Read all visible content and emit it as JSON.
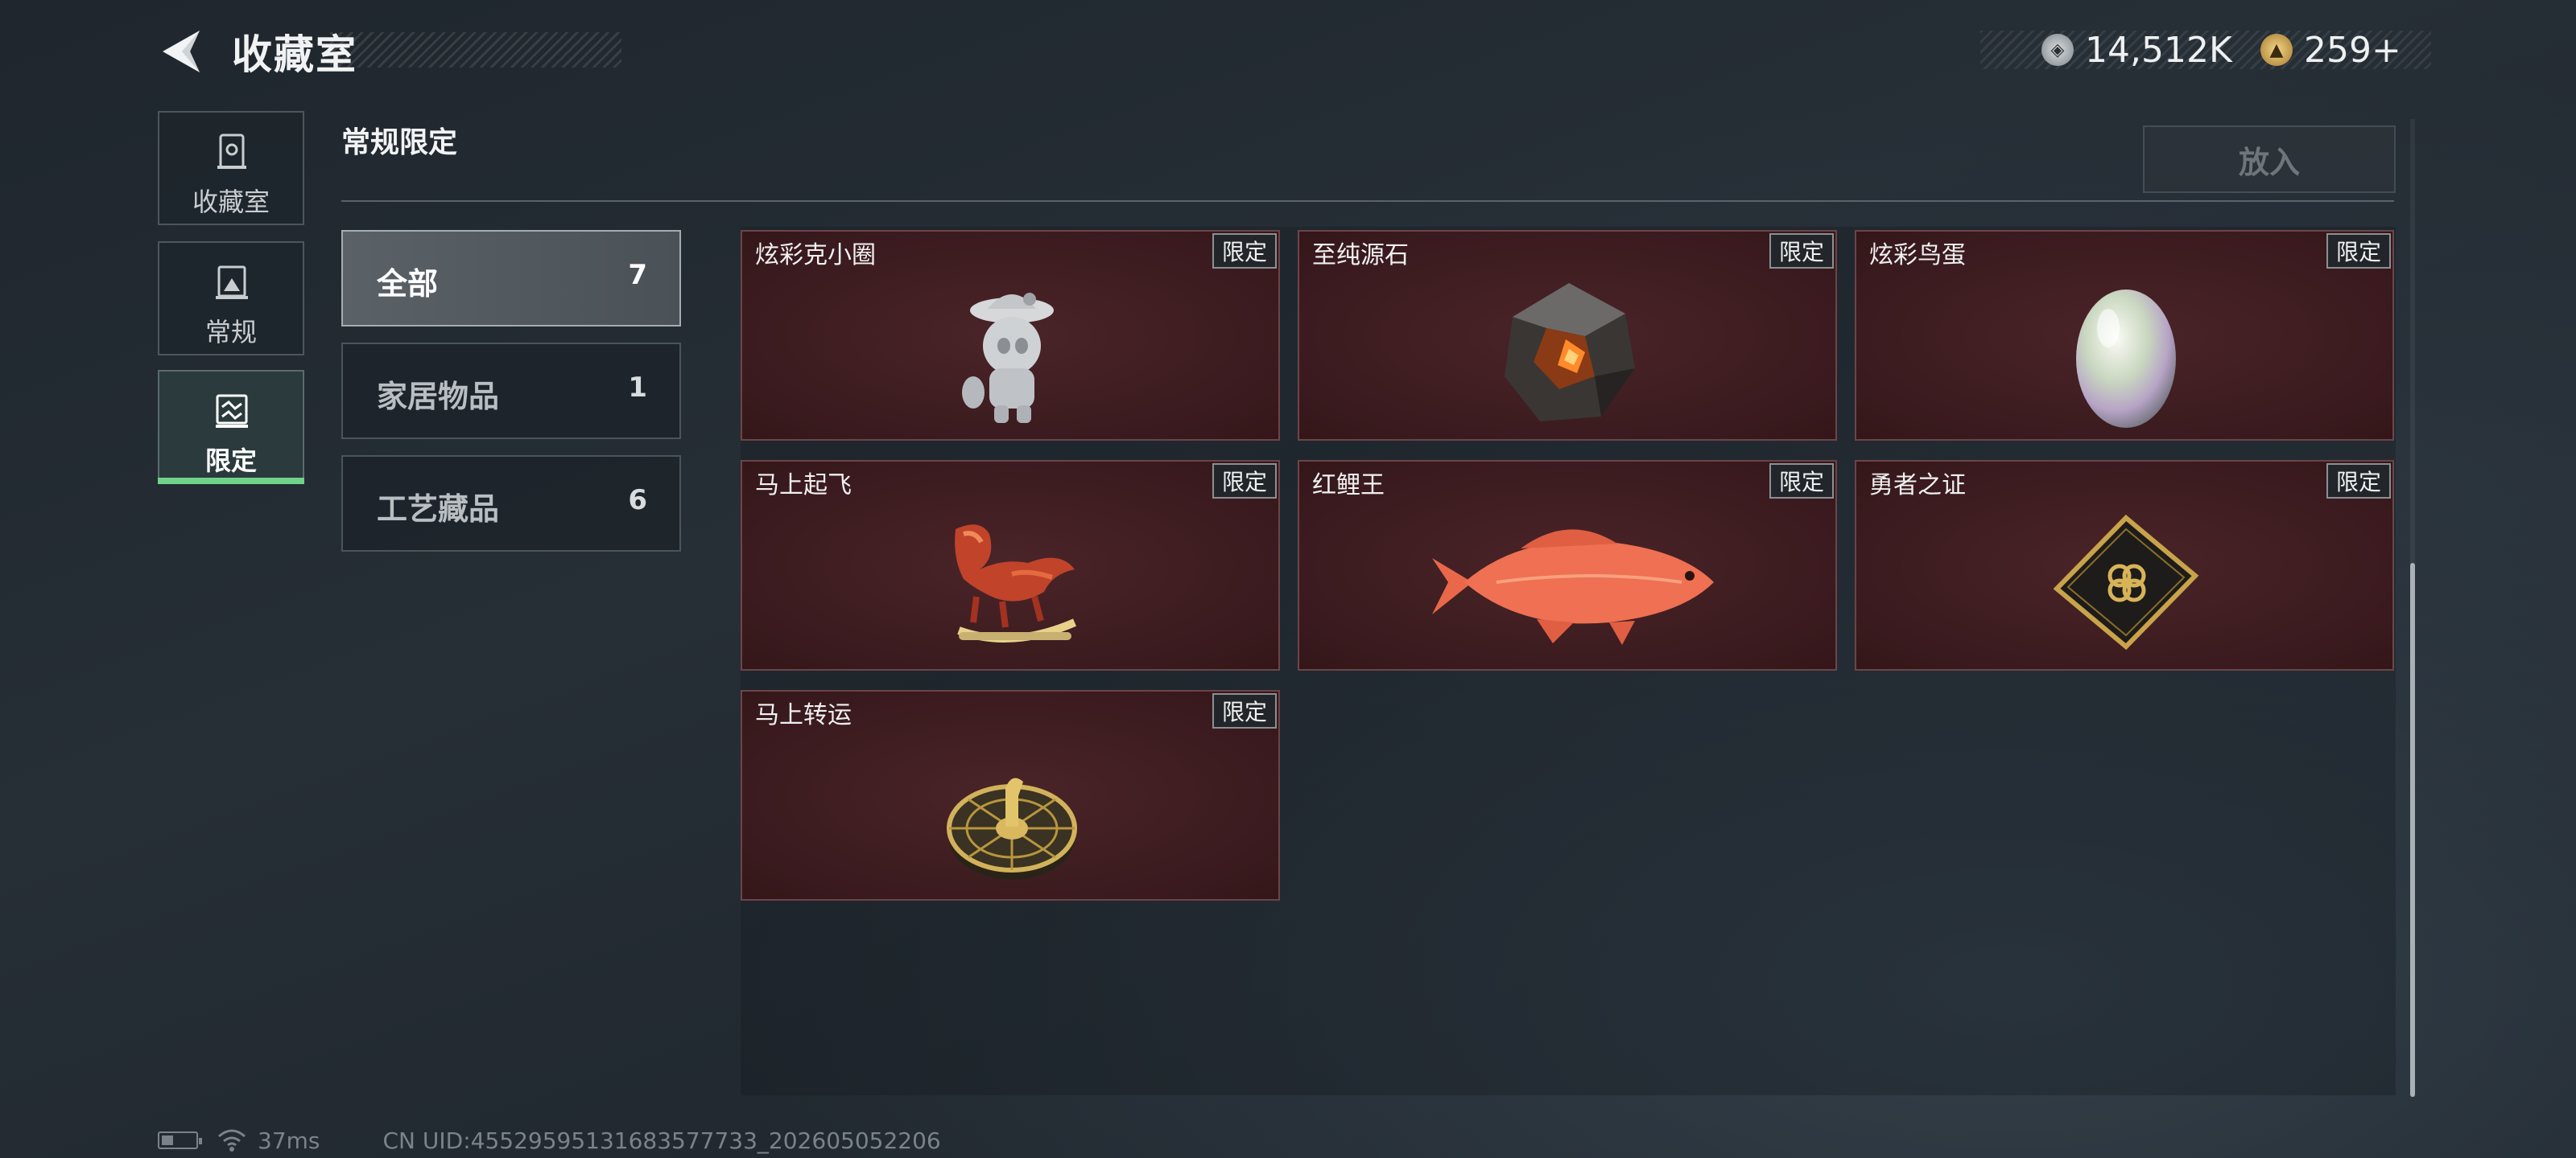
{
  "header": {
    "title": "收藏室"
  },
  "currency": {
    "silver_value": "14,512K",
    "gold_value": "259+"
  },
  "rail": [
    {
      "label": "收藏室",
      "icon": "collection-room-icon",
      "active": false
    },
    {
      "label": "常规",
      "icon": "gallery-icon",
      "active": false
    },
    {
      "label": "限定",
      "icon": "limited-icon",
      "active": true
    }
  ],
  "section": {
    "title": "常规限定",
    "put_button": "放入"
  },
  "categories": [
    {
      "name": "全部",
      "count": "7",
      "active": true
    },
    {
      "name": "家居物品",
      "count": "1",
      "active": false
    },
    {
      "name": "工艺藏品",
      "count": "6",
      "active": false
    }
  ],
  "items": [
    {
      "name": "炫彩克小圈",
      "tag": "限定",
      "icon": "figurine-icon"
    },
    {
      "name": "至纯源石",
      "tag": "限定",
      "icon": "crystal-icon"
    },
    {
      "name": "炫彩鸟蛋",
      "tag": "限定",
      "icon": "egg-icon"
    },
    {
      "name": "马上起飞",
      "tag": "限定",
      "icon": "horse-sculpture-icon"
    },
    {
      "name": "红鲤王",
      "tag": "限定",
      "icon": "carp-icon"
    },
    {
      "name": "勇者之证",
      "tag": "限定",
      "icon": "card-icon"
    },
    {
      "name": "马上转运",
      "tag": "限定",
      "icon": "wheel-icon"
    }
  ],
  "status": {
    "ping": "37ms",
    "uid": "CN UID:4552959513168357773 3_202605052206",
    "uid_text": "CN UID:45529595131683577733_202605052206"
  },
  "colors": {
    "accent_green": "#6fd38a",
    "card_bg": "#3b1b1f",
    "card_border": "#6b4548"
  }
}
